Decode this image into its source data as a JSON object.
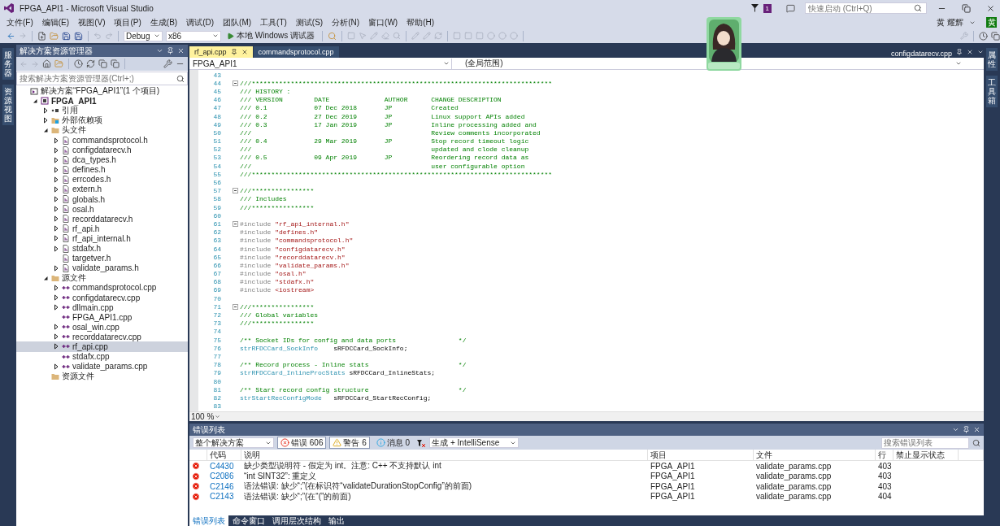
{
  "window": {
    "title": "FPGA_API1 - Microsoft Visual Studio",
    "notification_count": "1",
    "quick_launch": {
      "placeholder": "快速启动 (Ctrl+Q)"
    },
    "user": {
      "name": "黄 耀辉",
      "initial": "黄"
    }
  },
  "menu": [
    "文件(F)",
    "编辑(E)",
    "视图(V)",
    "项目(P)",
    "生成(B)",
    "调试(D)",
    "团队(M)",
    "工具(T)",
    "测试(S)",
    "分析(N)",
    "窗口(W)",
    "帮助(H)"
  ],
  "toolbar": {
    "configuration": "Debug",
    "platform": "x86",
    "run": "本地 Windows 调试器"
  },
  "left_strip": [
    "服务器",
    "资源视图"
  ],
  "right_strip": [
    "属性",
    "工具箱"
  ],
  "solution_explorer": {
    "title": "解决方案资源管理器",
    "search": {
      "placeholder": "搜索解决方案资源管理器(Ctrl+;)"
    },
    "tree": [
      {
        "label": "解决方案“FPGA_API1”(1 个项目)",
        "kind": "solution",
        "selected": false,
        "children": [
          {
            "label": "FPGA_API1",
            "kind": "project",
            "selected": false,
            "expanded": true,
            "children": [
              {
                "label": "引用",
                "kind": "reference",
                "selected": false,
                "expanded": false
              },
              {
                "label": "外部依赖项",
                "kind": "external",
                "selected": false,
                "expanded": false
              },
              {
                "label": "头文件",
                "kind": "folder",
                "selected": false,
                "expanded": true,
                "children": [
                  {
                    "label": "commandsprotocol.h",
                    "kind": "header",
                    "selected": false,
                    "expanded": false
                  },
                  {
                    "label": "configdatarecv.h",
                    "kind": "header",
                    "selected": false,
                    "expanded": false
                  },
                  {
                    "label": "dca_types.h",
                    "kind": "header",
                    "selected": false,
                    "expanded": false
                  },
                  {
                    "label": "defines.h",
                    "kind": "header",
                    "selected": false,
                    "expanded": false
                  },
                  {
                    "label": "errcodes.h",
                    "kind": "header",
                    "selected": false,
                    "expanded": false
                  },
                  {
                    "label": "extern.h",
                    "kind": "header",
                    "selected": false,
                    "expanded": false
                  },
                  {
                    "label": "globals.h",
                    "kind": "header",
                    "selected": false,
                    "expanded": false
                  },
                  {
                    "label": "osal.h",
                    "kind": "header",
                    "selected": false,
                    "expanded": false
                  },
                  {
                    "label": "recorddatarecv.h",
                    "kind": "header",
                    "selected": false,
                    "expanded": false
                  },
                  {
                    "label": "rf_api.h",
                    "kind": "header",
                    "selected": false,
                    "expanded": false
                  },
                  {
                    "label": "rf_api_internal.h",
                    "kind": "header",
                    "selected": false,
                    "expanded": false
                  },
                  {
                    "label": "stdafx.h",
                    "kind": "header",
                    "selected": false,
                    "expanded": false
                  },
                  {
                    "label": "targetver.h",
                    "kind": "header",
                    "selected": false
                  },
                  {
                    "label": "validate_params.h",
                    "kind": "header",
                    "selected": false,
                    "expanded": false
                  }
                ]
              },
              {
                "label": "源文件",
                "kind": "folder",
                "selected": false,
                "expanded": true,
                "children": [
                  {
                    "label": "commandsprotocol.cpp",
                    "kind": "source",
                    "selected": false,
                    "expanded": false
                  },
                  {
                    "label": "configdatarecv.cpp",
                    "kind": "source",
                    "selected": false,
                    "expanded": false
                  },
                  {
                    "label": "dllmain.cpp",
                    "kind": "source",
                    "selected": false,
                    "expanded": false
                  },
                  {
                    "label": "FPGA_API1.cpp",
                    "kind": "source",
                    "selected": false
                  },
                  {
                    "label": "osal_win.cpp",
                    "kind": "source",
                    "selected": false,
                    "expanded": false
                  },
                  {
                    "label": "recorddatarecv.cpp",
                    "kind": "source",
                    "selected": false,
                    "expanded": false
                  },
                  {
                    "label": "rf_api.cpp",
                    "kind": "source",
                    "selected": true,
                    "expanded": false
                  },
                  {
                    "label": "stdafx.cpp",
                    "kind": "source",
                    "selected": false
                  },
                  {
                    "label": "validate_params.cpp",
                    "kind": "source",
                    "selected": false,
                    "expanded": false
                  }
                ]
              },
              {
                "label": "资源文件",
                "kind": "folder",
                "selected": false
              }
            ]
          }
        ]
      }
    ]
  },
  "editor": {
    "tabs": [
      {
        "label": "rf_api.cpp",
        "selected": true
      },
      {
        "label": "commandsprotocol.cpp",
        "selected": false
      }
    ],
    "preview_tab": {
      "label": "configdatarecv.cpp"
    },
    "project_dropdown": "FPGA_API1",
    "scope_dropdown": "(全局范围)",
    "zoom": "100 %",
    "lines": [
      {
        "n": "43"
      },
      {
        "n": "44",
        "fold": true,
        "tokens": [
          {
            "kind": "comment",
            "text": "///*****************************************************************************"
          }
        ]
      },
      {
        "n": "45",
        "tokens": [
          {
            "kind": "comment",
            "text": "/// HISTORY :"
          }
        ]
      },
      {
        "n": "46",
        "tokens": [
          {
            "kind": "comment",
            "text": "/// VERSION        DATE              AUTHOR      CHANGE DESCRIPTION"
          }
        ]
      },
      {
        "n": "47",
        "tokens": [
          {
            "kind": "comment",
            "text": "/// 0.1            07 Dec 2018       JP          Created"
          }
        ]
      },
      {
        "n": "48",
        "tokens": [
          {
            "kind": "comment",
            "text": "/// 0.2            27 Dec 2019       JP          Linux support APIs added"
          }
        ]
      },
      {
        "n": "49",
        "tokens": [
          {
            "kind": "comment",
            "text": "/// 0.3            17 Jan 2019       JP          Inline processing added and"
          }
        ]
      },
      {
        "n": "50",
        "tokens": [
          {
            "kind": "comment",
            "text": "///                                              Review comments incorporated"
          }
        ]
      },
      {
        "n": "51",
        "tokens": [
          {
            "kind": "comment",
            "text": "/// 0.4            29 Mar 2019       JP          Stop record timeout logic"
          }
        ]
      },
      {
        "n": "52",
        "tokens": [
          {
            "kind": "comment",
            "text": "///                                              updated and clode cleanup"
          }
        ]
      },
      {
        "n": "53",
        "tokens": [
          {
            "kind": "comment",
            "text": "/// 0.5            09 Apr 2019       JP          Reordering record data as"
          }
        ]
      },
      {
        "n": "54",
        "tokens": [
          {
            "kind": "comment",
            "text": "///                                              user configurable option"
          }
        ]
      },
      {
        "n": "55",
        "tokens": [
          {
            "kind": "comment",
            "text": "///*****************************************************************************"
          }
        ]
      },
      {
        "n": "56"
      },
      {
        "n": "57",
        "fold": true,
        "tokens": [
          {
            "kind": "comment",
            "text": "///****************"
          }
        ]
      },
      {
        "n": "58",
        "tokens": [
          {
            "kind": "comment",
            "text": "/// Includes"
          }
        ]
      },
      {
        "n": "59",
        "tokens": [
          {
            "kind": "comment",
            "text": "///****************"
          }
        ]
      },
      {
        "n": "60"
      },
      {
        "n": "61",
        "fold": true,
        "tokens": [
          {
            "kind": "preproc",
            "text": "#include "
          },
          {
            "kind": "string",
            "text": "\"rf_api_internal.h\""
          }
        ]
      },
      {
        "n": "62",
        "tokens": [
          {
            "kind": "preproc",
            "text": "#include "
          },
          {
            "kind": "string",
            "text": "\"defines.h\""
          }
        ]
      },
      {
        "n": "63",
        "tokens": [
          {
            "kind": "preproc",
            "text": "#include "
          },
          {
            "kind": "string",
            "text": "\"commandsprotocol.h\""
          }
        ]
      },
      {
        "n": "64",
        "tokens": [
          {
            "kind": "preproc",
            "text": "#include "
          },
          {
            "kind": "string",
            "text": "\"configdatarecv.h\""
          }
        ]
      },
      {
        "n": "65",
        "tokens": [
          {
            "kind": "preproc",
            "text": "#include "
          },
          {
            "kind": "string",
            "text": "\"recorddatarecv.h\""
          }
        ]
      },
      {
        "n": "66",
        "tokens": [
          {
            "kind": "preproc",
            "text": "#include "
          },
          {
            "kind": "string",
            "text": "\"validate_params.h\""
          }
        ]
      },
      {
        "n": "67",
        "tokens": [
          {
            "kind": "preproc",
            "text": "#include "
          },
          {
            "kind": "string",
            "text": "\"osal.h\""
          }
        ]
      },
      {
        "n": "68",
        "tokens": [
          {
            "kind": "preproc",
            "text": "#include "
          },
          {
            "kind": "string",
            "text": "\"stdafx.h\""
          }
        ]
      },
      {
        "n": "69",
        "tokens": [
          {
            "kind": "preproc",
            "text": "#include "
          },
          {
            "kind": "string",
            "text": "<iostream>"
          }
        ]
      },
      {
        "n": "70"
      },
      {
        "n": "71",
        "fold": true,
        "tokens": [
          {
            "kind": "comment",
            "text": "///****************"
          }
        ]
      },
      {
        "n": "72",
        "tokens": [
          {
            "kind": "comment",
            "text": "/// Global variables"
          }
        ]
      },
      {
        "n": "73",
        "tokens": [
          {
            "kind": "comment",
            "text": "///****************"
          }
        ]
      },
      {
        "n": "74"
      },
      {
        "n": "75",
        "tokens": [
          {
            "kind": "comment",
            "text": "/** Socket IDs for config and data ports                */"
          }
        ]
      },
      {
        "n": "76",
        "tokens": [
          {
            "kind": "type",
            "text": "strRFDCCard_SockInfo"
          },
          {
            "kind": "plain",
            "text": "    sRFDCCard_SockInfo;"
          }
        ]
      },
      {
        "n": "77"
      },
      {
        "n": "78",
        "tokens": [
          {
            "kind": "comment",
            "text": "/** Record process - Inline stats                       */"
          }
        ]
      },
      {
        "n": "79",
        "tokens": [
          {
            "kind": "type",
            "text": "strRFDCCard_InlineProcStats"
          },
          {
            "kind": "plain",
            "text": " sRFDCCard_InlineStats;"
          }
        ]
      },
      {
        "n": "80"
      },
      {
        "n": "81",
        "tokens": [
          {
            "kind": "comment",
            "text": "/** Start record config structure                       */"
          }
        ]
      },
      {
        "n": "82",
        "tokens": [
          {
            "kind": "type",
            "text": "strStartRecConfigMode"
          },
          {
            "kind": "plain",
            "text": "   sRFDCCard_StartRecConfig;"
          }
        ]
      },
      {
        "n": "83"
      }
    ]
  },
  "error_list": {
    "title": "错误列表",
    "scope": "整个解决方案",
    "filters": [
      {
        "kind": "error",
        "label": "错误 606",
        "selected": true
      },
      {
        "kind": "warning",
        "label": "警告 6",
        "selected": true
      },
      {
        "kind": "message",
        "label": "消息 0",
        "selected": false
      }
    ],
    "source": "生成 + IntelliSense",
    "search": {
      "placeholder": "搜索错误列表"
    },
    "columns": [
      "代码",
      "说明",
      "项目",
      "文件",
      "行",
      "禁止显示状态"
    ],
    "rows": [
      {
        "code": "C4430",
        "description": "缺少类型说明符 - 假定为 int。注意: C++ 不支持默认 int",
        "project": "FPGA_API1",
        "file": "validate_params.cpp",
        "line": "403"
      },
      {
        "code": "C2086",
        "description": "“int SINT32”: 重定义",
        "project": "FPGA_API1",
        "file": "validate_params.cpp",
        "line": "403"
      },
      {
        "code": "C2146",
        "description": "语法错误: 缺少“;”(在标识符“validateDurationStopConfig”的前面)",
        "project": "FPGA_API1",
        "file": "validate_params.cpp",
        "line": "403"
      },
      {
        "code": "C2143",
        "description": "语法错误: 缺少“;”(在“(”的前面)",
        "project": "FPGA_API1",
        "file": "validate_params.cpp",
        "line": "404"
      }
    ]
  },
  "bottom_tabs": [
    {
      "label": "错误列表",
      "selected": true
    },
    {
      "label": "命令窗口",
      "selected": false
    },
    {
      "label": "调用层次结构",
      "selected": false
    },
    {
      "label": "输出",
      "selected": false
    }
  ],
  "sticker": {
    "kind": "picture"
  }
}
